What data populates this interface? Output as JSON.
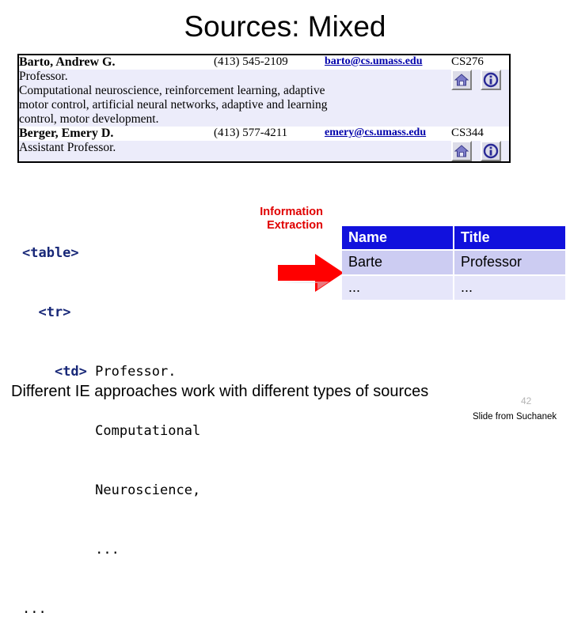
{
  "slide": {
    "title": "Sources: Mixed",
    "footer_note": "Different IE approaches work with different types of sources",
    "slide_number": "42",
    "credit": "Slide from Suchanek"
  },
  "source_table": {
    "rows": [
      {
        "name": "Barto, Andrew G.",
        "phone": "(413) 545-2109",
        "email": "barto@cs.umass.edu",
        "course": "CS276",
        "description": [
          "Professor.",
          "Computational neuroscience, reinforcement learning, adaptive",
          "motor control, artificial neural networks, adaptive and learning",
          "control, motor development."
        ],
        "icons": [
          "home-icon",
          "info-icon"
        ]
      },
      {
        "name": "Berger, Emery D.",
        "phone": "(413) 577-4211",
        "email": "emery@cs.umass.edu",
        "course": "CS344",
        "description": [
          "Assistant Professor."
        ],
        "icons": [
          "home-icon",
          "info-icon"
        ]
      }
    ]
  },
  "code_block": {
    "lines": [
      {
        "indent": 0,
        "tag": "<table>",
        "text": ""
      },
      {
        "indent": 2,
        "tag": "<tr>",
        "text": ""
      },
      {
        "indent": 4,
        "tag": "<td>",
        "text": " Professor."
      },
      {
        "indent": 4,
        "tag": "",
        "text": "     Computational"
      },
      {
        "indent": 4,
        "tag": "",
        "text": "     Neuroscience,"
      },
      {
        "indent": 4,
        "tag": "",
        "text": "     ..."
      },
      {
        "indent": 0,
        "tag": "",
        "text": "..."
      }
    ]
  },
  "transform": {
    "label_line1": "Information",
    "label_line2": "Extraction",
    "arrow_color": "#ff0000",
    "label_color": "#e00000"
  },
  "output_table": {
    "headers": [
      "Name",
      "Title"
    ],
    "rows": [
      [
        "Barte",
        "Professor"
      ],
      [
        "...",
        "..."
      ]
    ],
    "header_bg": "#1111dd",
    "row1_bg": "#ccccf2",
    "row2_bg": "#e6e6fa"
  }
}
